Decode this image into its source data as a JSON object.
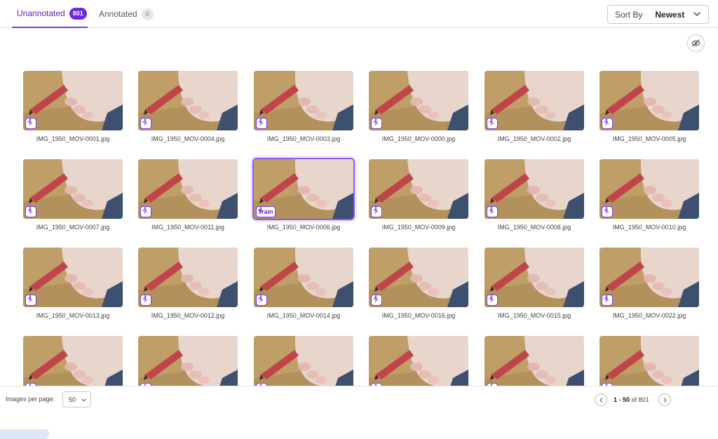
{
  "tabs": {
    "unannotated": {
      "label": "Unannotated",
      "count": "801"
    },
    "annotated": {
      "label": "Annotated",
      "count": "0"
    }
  },
  "sort": {
    "label": "Sort By",
    "value": "Newest"
  },
  "tag_label": "Train",
  "images": [
    {
      "name": "IMG_1950_MOV-0001.jpg",
      "selected": false
    },
    {
      "name": "IMG_1950_MOV-0004.jpg",
      "selected": false
    },
    {
      "name": "IMG_1950_MOV-0003.jpg",
      "selected": false
    },
    {
      "name": "IMG_1950_MOV-0000.jpg",
      "selected": false
    },
    {
      "name": "IMG_1950_MOV-0002.jpg",
      "selected": false
    },
    {
      "name": "IMG_1950_MOV-0005.jpg",
      "selected": false
    },
    {
      "name": "IMG_1950_MOV-0007.jpg",
      "selected": false
    },
    {
      "name": "IMG_1950_MOV-0011.jpg",
      "selected": false
    },
    {
      "name": "IMG_1950_MOV-0006.jpg",
      "selected": true
    },
    {
      "name": "IMG_1950_MOV-0009.jpg",
      "selected": false
    },
    {
      "name": "IMG_1950_MOV-0008.jpg",
      "selected": false
    },
    {
      "name": "IMG_1950_MOV-0010.jpg",
      "selected": false
    },
    {
      "name": "IMG_1950_MOV-0013.jpg",
      "selected": false
    },
    {
      "name": "IMG_1950_MOV-0012.jpg",
      "selected": false
    },
    {
      "name": "IMG_1950_MOV-0014.jpg",
      "selected": false
    },
    {
      "name": "IMG_1950_MOV-0016.jpg",
      "selected": false
    },
    {
      "name": "IMG_1950_MOV-0015.jpg",
      "selected": false
    },
    {
      "name": "IMG_1950_MOV-0022.jpg",
      "selected": false
    },
    {
      "name": "",
      "selected": false
    },
    {
      "name": "",
      "selected": false
    },
    {
      "name": "",
      "selected": false
    },
    {
      "name": "",
      "selected": false
    },
    {
      "name": "",
      "selected": false
    },
    {
      "name": "",
      "selected": false
    }
  ],
  "footer": {
    "images_per_page_label": "Images per page:",
    "images_per_page_value": "50",
    "range": "1 - 50",
    "of_label": "of",
    "total": "801"
  },
  "icons": {
    "sort_chevron": "chevron-down-icon",
    "hide": "eye-off-icon",
    "tag": "running-person-icon",
    "prev": "chevron-left-icon",
    "next": "chevron-right-icon"
  },
  "colors": {
    "accent": "#7c3aed",
    "accent_dark": "#5b21b6",
    "border": "#e3e3e3"
  }
}
